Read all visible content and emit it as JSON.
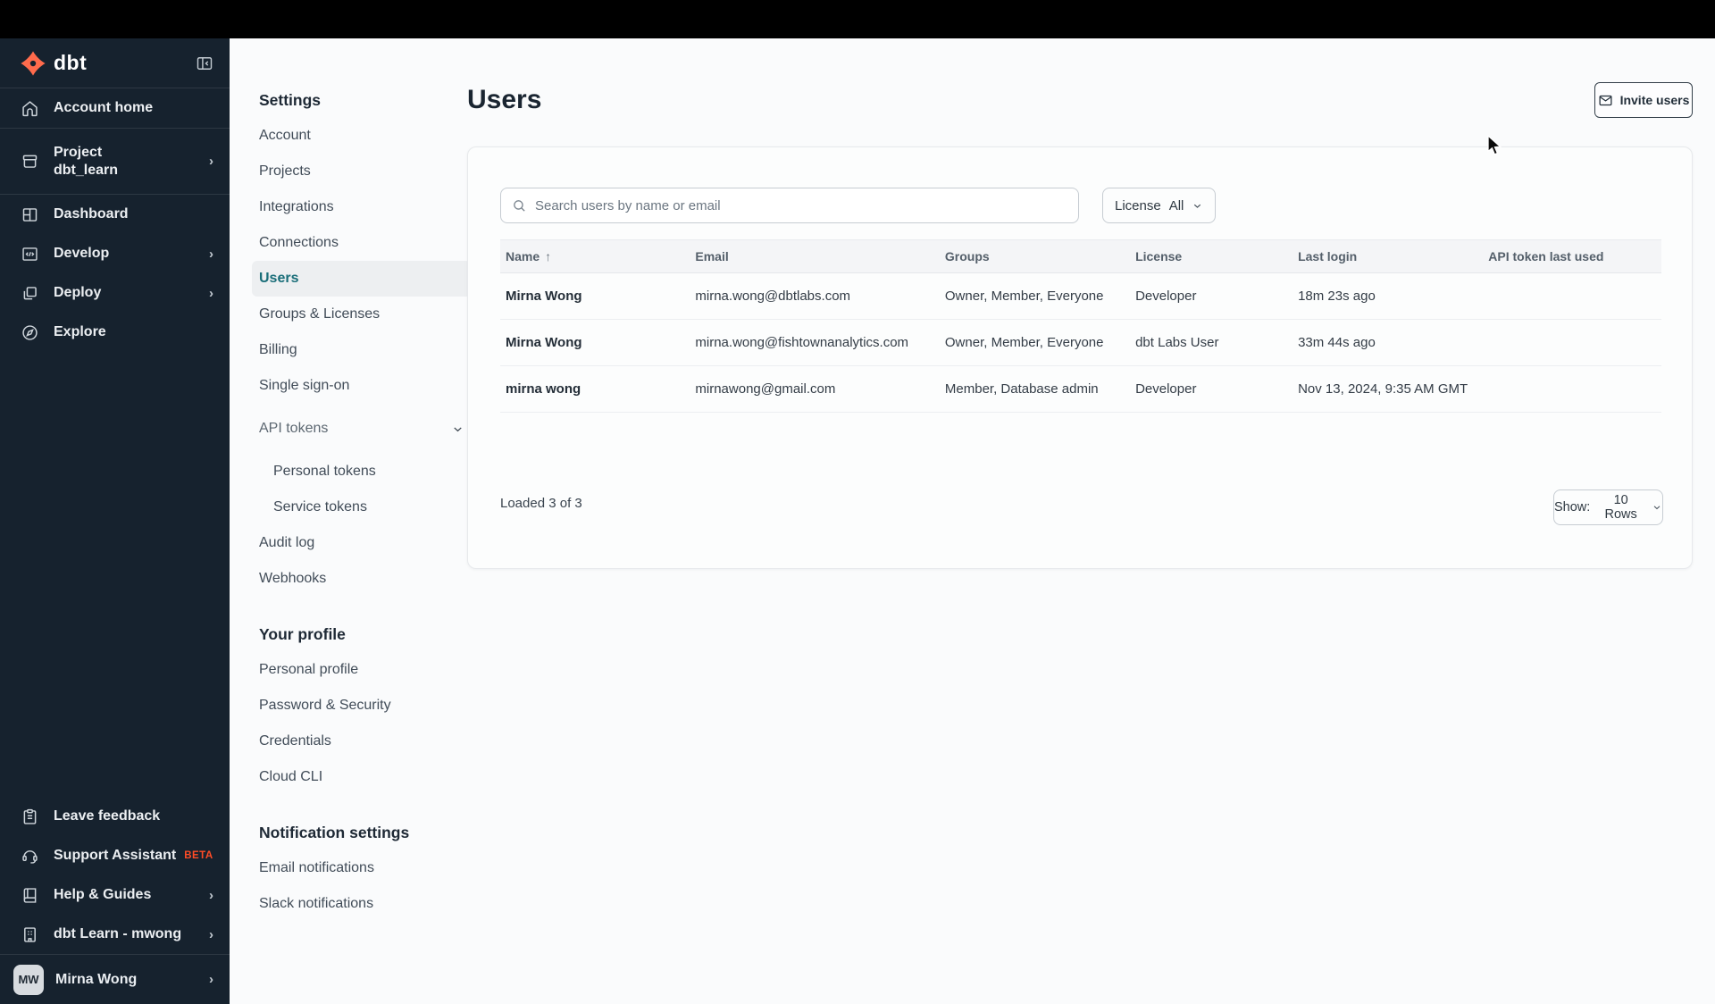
{
  "colors": {
    "brand_orange": "#ff6b4c",
    "accent_teal": "#1a6e79",
    "sidebar_bg": "#16222e",
    "beta_orange": "#ff4c26"
  },
  "sidebar": {
    "logo_text": "dbt",
    "account_home": "Account home",
    "project_label": "Project",
    "project_name": "dbt_learn",
    "dashboard": "Dashboard",
    "develop": "Develop",
    "deploy": "Deploy",
    "explore": "Explore",
    "leave_feedback": "Leave feedback",
    "support_assistant": "Support Assistant",
    "support_badge": "BETA",
    "help_guides": "Help & Guides",
    "org_switcher": "dbt Learn - mwong",
    "user": {
      "initials": "MW",
      "name": "Mirna Wong"
    }
  },
  "settings_nav": {
    "sections": [
      {
        "heading": "Settings",
        "items": [
          {
            "label": "Account"
          },
          {
            "label": "Projects"
          },
          {
            "label": "Integrations"
          },
          {
            "label": "Connections"
          },
          {
            "label": "Users"
          },
          {
            "label": "Groups & Licenses"
          },
          {
            "label": "Billing"
          },
          {
            "label": "Single sign-on"
          },
          {
            "label": "API tokens"
          },
          {
            "label": "Personal tokens"
          },
          {
            "label": "Service tokens"
          },
          {
            "label": "Audit log"
          },
          {
            "label": "Webhooks"
          }
        ]
      },
      {
        "heading": "Your profile",
        "items": [
          {
            "label": "Personal profile"
          },
          {
            "label": "Password & Security"
          },
          {
            "label": "Credentials"
          },
          {
            "label": "Cloud CLI"
          }
        ]
      },
      {
        "heading": "Notification settings",
        "items": [
          {
            "label": "Email notifications"
          },
          {
            "label": "Slack notifications"
          }
        ]
      }
    ]
  },
  "main": {
    "title": "Users",
    "invite_button": "Invite users",
    "search_placeholder": "Search users by name or email",
    "license_filter": {
      "label": "License",
      "value": "All"
    },
    "table": {
      "columns": [
        "Name",
        "Email",
        "Groups",
        "License",
        "Last login",
        "API token last used"
      ],
      "sort_arrow": "↑",
      "rows": [
        {
          "name": "Mirna Wong",
          "email": "mirna.wong@dbtlabs.com",
          "groups": "Owner, Member, Everyone",
          "license": "Developer",
          "last_login": "18m 23s ago",
          "api_token_last_used": ""
        },
        {
          "name": "Mirna Wong",
          "email": "mirna.wong@fishtownanalytics.com",
          "groups": "Owner, Member, Everyone",
          "license": "dbt Labs User",
          "last_login": "33m 44s ago",
          "api_token_last_used": ""
        },
        {
          "name": "mirna wong",
          "email": "mirnawong@gmail.com",
          "groups": "Member, Database admin",
          "license": "Developer",
          "last_login": "Nov 13, 2024, 9:35 AM GMT",
          "api_token_last_used": ""
        }
      ]
    },
    "footer": {
      "loaded_text": "Loaded 3 of 3",
      "show_label": "Show:",
      "show_value": "10 Rows"
    }
  }
}
